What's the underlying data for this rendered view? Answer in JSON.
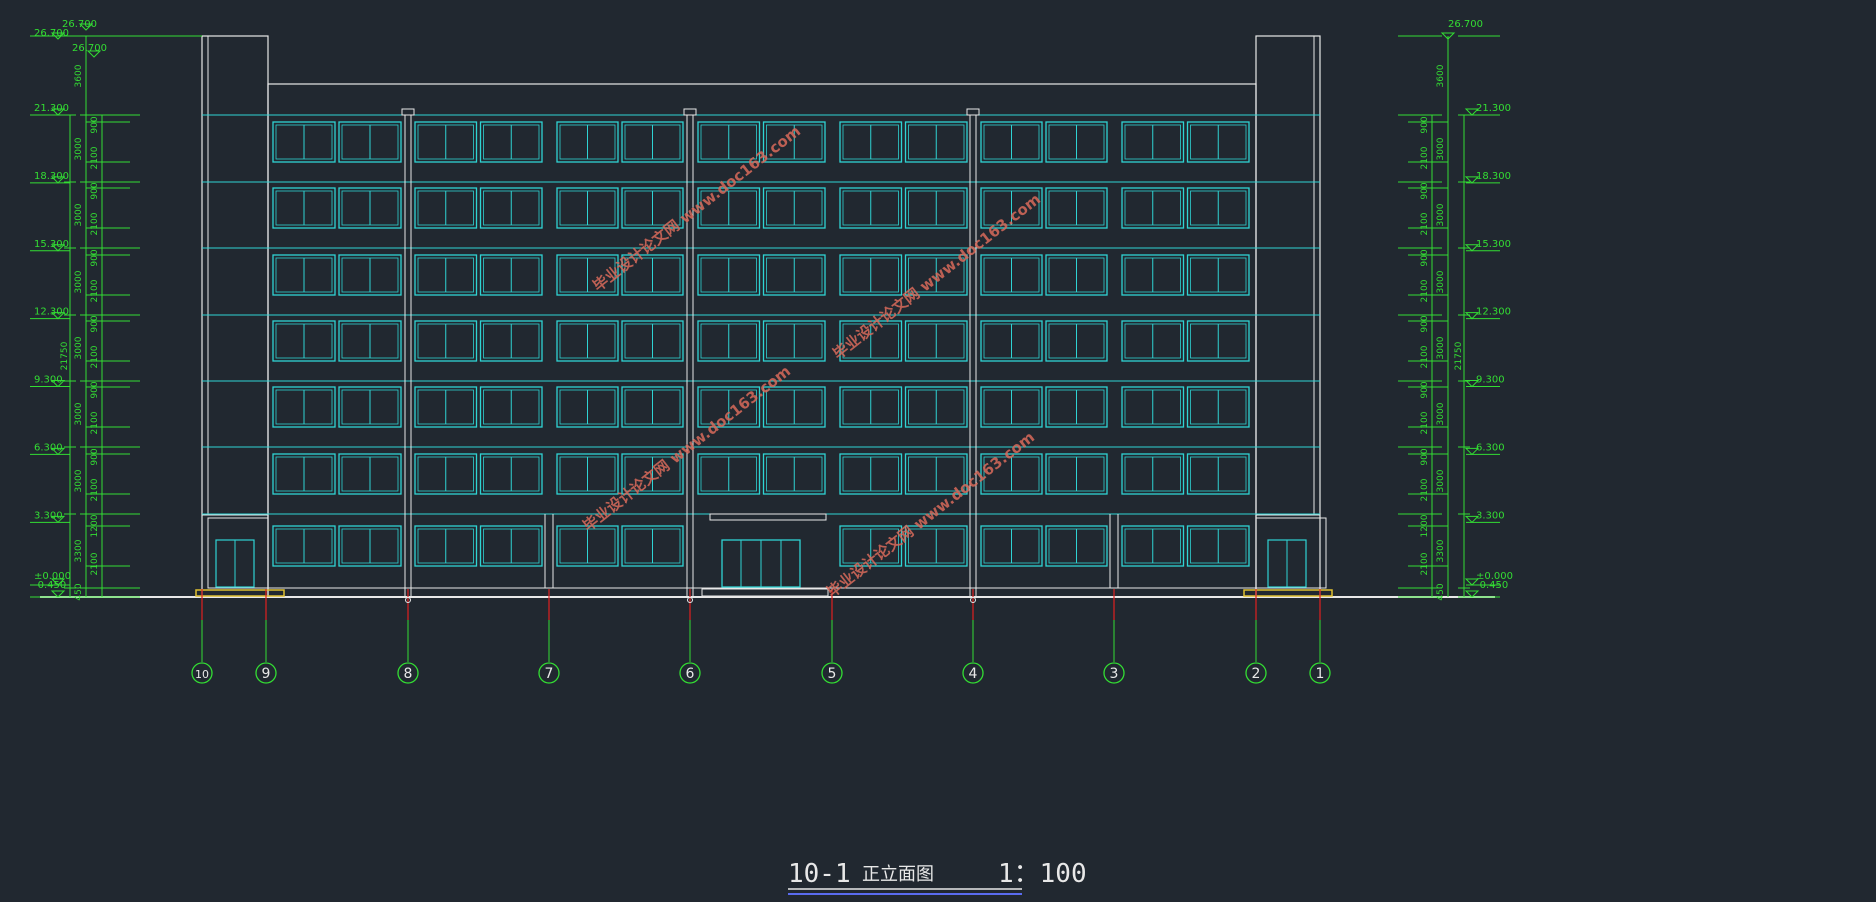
{
  "drawing": {
    "title_number": "10-1",
    "title_name": "正立面图",
    "scale": "1：100"
  },
  "levels": [
    {
      "label": "26.700",
      "elevation": 26.7
    },
    {
      "label": "21.300",
      "elevation": 21.3
    },
    {
      "label": "18.300",
      "elevation": 18.3
    },
    {
      "label": "15.300",
      "elevation": 15.3
    },
    {
      "label": "12.300",
      "elevation": 12.3
    },
    {
      "label": "9.300",
      "elevation": 9.3
    },
    {
      "label": "6.300",
      "elevation": 6.3
    },
    {
      "label": "3.300",
      "elevation": 3.3
    },
    {
      "label": "±0.000",
      "elevation": 0
    },
    {
      "label": "-0.450",
      "elevation": -0.45
    }
  ],
  "roof_level_label": "26.700",
  "parapet_dim": "3600",
  "total_dim": "21750",
  "floor_dims": [
    "3000",
    "3000",
    "3000",
    "3000",
    "3000",
    "3000",
    "3300"
  ],
  "window_dims": [
    "900",
    "2100"
  ],
  "ground_dims": [
    "1200",
    "2100"
  ],
  "base_dim": "450",
  "axes": [
    "10",
    "9",
    "8",
    "7",
    "6",
    "5",
    "4",
    "3",
    "2",
    "1"
  ],
  "watermark": "毕业设计论文网 www.doc163.com",
  "colors": {
    "background": "#212830",
    "outline": "#e8e8e8",
    "window": "#2fd3d3",
    "dimension": "#33dd33",
    "axis_tick": "#e02020",
    "watermark": "#d86a5a"
  }
}
